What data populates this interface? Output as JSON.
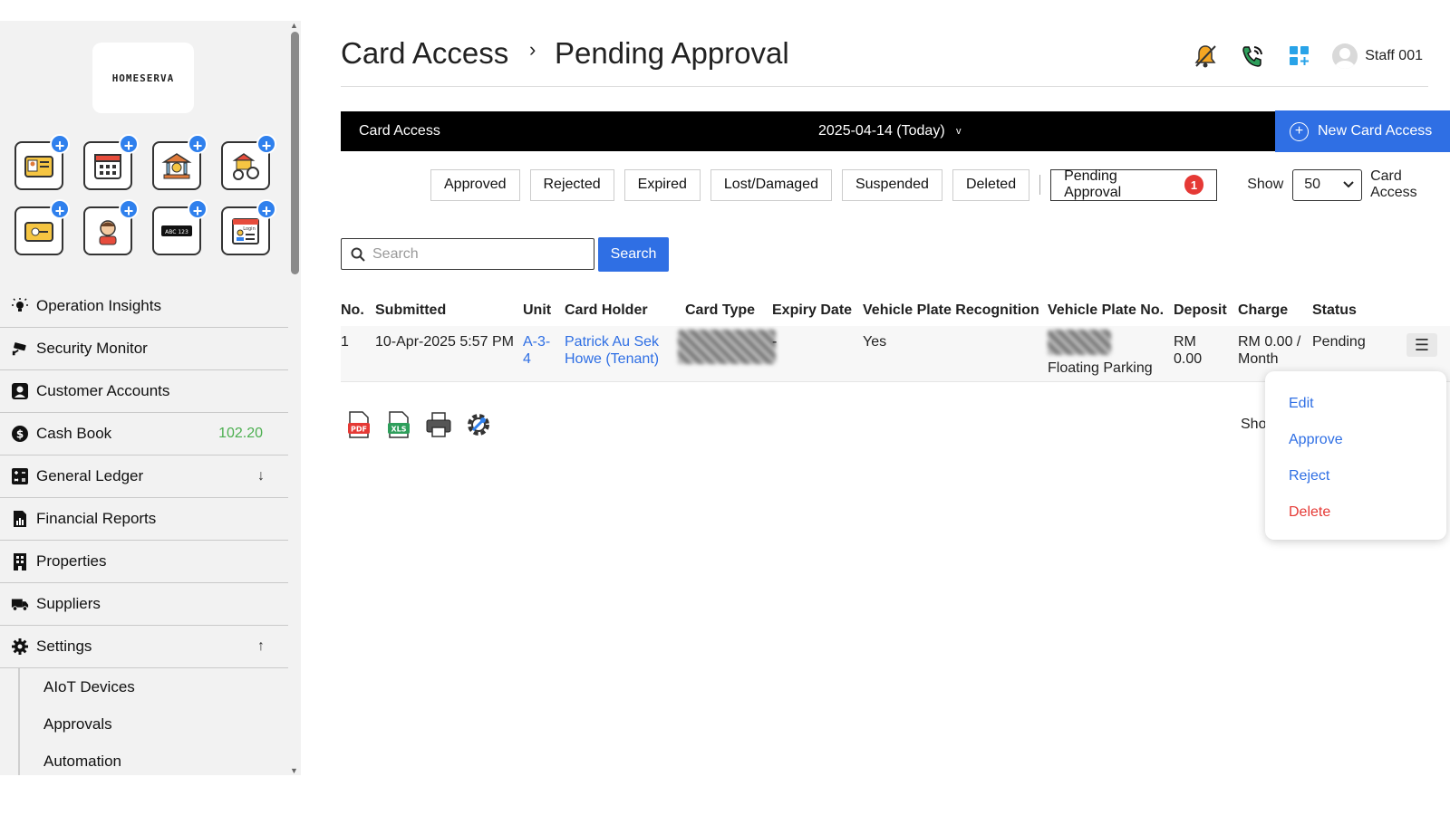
{
  "app": {
    "logo_text": "HOMESERVA"
  },
  "quick_actions": [
    {
      "icon": "id-card-icon"
    },
    {
      "icon": "calendar-icon"
    },
    {
      "icon": "bank-money-icon"
    },
    {
      "icon": "parking-icon"
    },
    {
      "icon": "access-card-key-icon"
    },
    {
      "icon": "visitor-face-icon"
    },
    {
      "icon": "plate-abc123-icon",
      "text": "ABC 123"
    },
    {
      "icon": "login-profile-icon",
      "text": "Login"
    }
  ],
  "sidebar": {
    "items": [
      {
        "label": "Operation Insights",
        "icon": "lightbulb-icon"
      },
      {
        "label": "Security Monitor",
        "icon": "cctv-icon"
      },
      {
        "label": "Customer Accounts",
        "icon": "user-account-icon"
      },
      {
        "label": "Cash Book",
        "icon": "dollar-circle-icon",
        "amount": "102.20"
      },
      {
        "label": "General Ledger",
        "icon": "calculator-icon",
        "extra": "↓"
      },
      {
        "label": "Financial Reports",
        "icon": "report-chart-icon"
      },
      {
        "label": "Properties",
        "icon": "building-icon"
      },
      {
        "label": "Suppliers",
        "icon": "truck-icon"
      },
      {
        "label": "Settings",
        "icon": "gear-icon",
        "extra": "↑"
      }
    ],
    "sub_items": [
      "AIoT Devices",
      "Approvals",
      "Automation"
    ]
  },
  "header": {
    "breadcrumb_1": "Card Access",
    "breadcrumb_sep": "›",
    "breadcrumb_2": "Pending Approval",
    "user_name": "Staff 001"
  },
  "topbar": {
    "title": "Card Access",
    "date": "2025-04-14 (Today)",
    "caret": "v",
    "new_button": "New Card Access"
  },
  "filters": {
    "tabs": [
      "Approved",
      "Rejected",
      "Expired",
      "Lost/Damaged",
      "Suspended",
      "Deleted"
    ],
    "active_tab": "Pending Approval",
    "active_count": "1",
    "show_label": "Show",
    "show_value": "50",
    "show_after": "Card Access"
  },
  "search": {
    "placeholder": "Search",
    "button": "Search"
  },
  "table": {
    "headers": {
      "no": "No.",
      "submitted": "Submitted",
      "unit": "Unit",
      "holder": "Card Holder",
      "type": "Card Type",
      "expiry": "Expiry Date",
      "vpr": "Vehicle Plate Recognition",
      "plate": "Vehicle Plate No.",
      "deposit": "Deposit",
      "charge": "Charge",
      "status": "Status"
    },
    "row": {
      "no": "1",
      "submitted": "10-Apr-2025 5:57 PM",
      "unit_1": "A-3-",
      "unit_2": "4",
      "holder_1": "Patrick Au Sek",
      "holder_2": "Howe (Tenant)",
      "expiry": "-",
      "vpr": "Yes",
      "plate_note": "Floating Parking",
      "deposit_1": "RM",
      "deposit_2": "0.00",
      "charge_1": "RM 0.00 /",
      "charge_2": "Month",
      "status": "Pending",
      "menu_icon": "☰"
    }
  },
  "row_menu": {
    "edit": "Edit",
    "approve": "Approve",
    "reject": "Reject",
    "delete": "Delete"
  },
  "exports": [
    "pdf-icon",
    "xls-icon",
    "print-icon",
    "settings-wrench-icon"
  ],
  "footer": {
    "show_truncated": "Sho"
  },
  "colors": {
    "accent": "#2f6fe4",
    "badge": "#e53935",
    "amount": "#4caf50",
    "topbar": "#000000"
  }
}
